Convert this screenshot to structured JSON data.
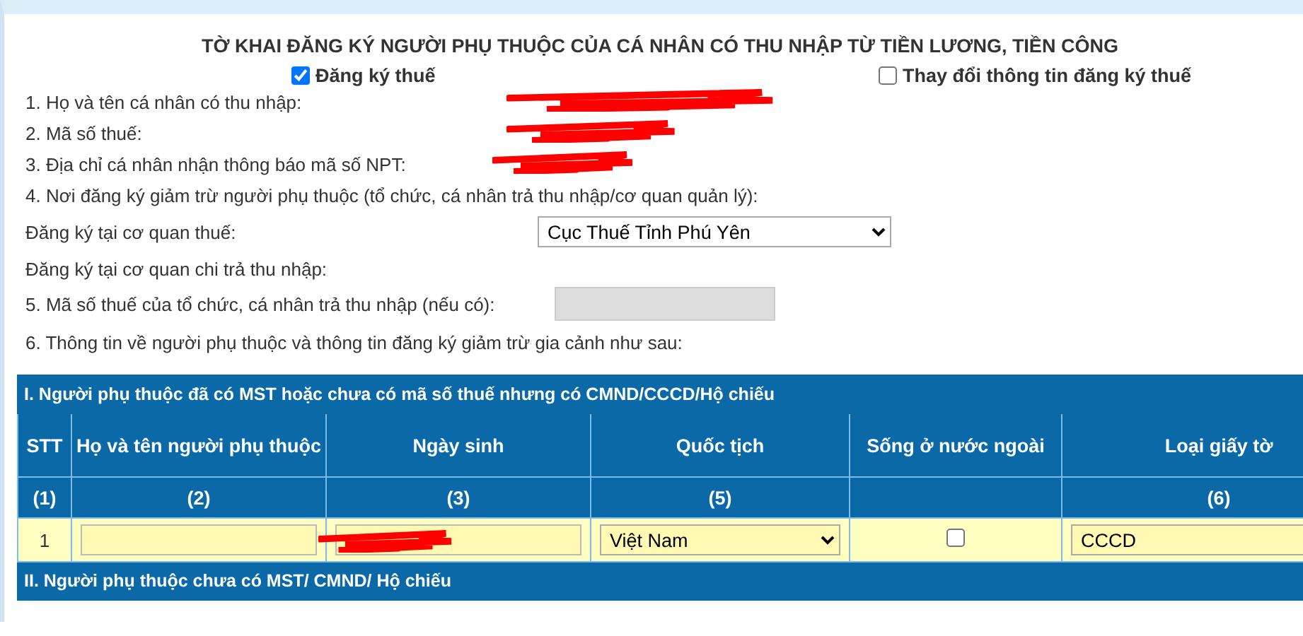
{
  "form": {
    "title": "TỜ KHAI ĐĂNG KÝ NGƯỜI PHỤ THUỘC CỦA CÁ NHÂN CÓ THU NHẬP TỪ TIỀN LƯƠNG, TIỀN CÔNG",
    "registration_types": [
      {
        "label": "Đăng ký thuế",
        "checked": true
      },
      {
        "label": "Thay đổi thông tin đăng ký thuế",
        "checked": false
      }
    ],
    "taxpayer_fields": [
      {
        "label": "1. Họ và tên cá nhân có thu nhập:",
        "redacted": true
      },
      {
        "label": "2. Mã số thuế:",
        "redacted": true
      },
      {
        "label": "3. Địa chỉ cá nhân nhận thông báo mã số NPT:",
        "redacted": true
      }
    ],
    "section_4": "4. Nơi đăng ký giảm trừ người phụ thuộc (tổ chức, cá nhân trả thu nhập/cơ quan quản lý):",
    "tax_office": {
      "label": "Đăng ký tại cơ quan thuế:",
      "value": "Cục Thuế Tỉnh Phú Yên"
    },
    "payer_office": "Đăng ký tại cơ quan chi trả thu nhập:",
    "payer_tax_code": {
      "label": "5. Mã số thuế của tổ chức, cá nhân trả thu nhập (nếu có):",
      "disabled": true
    },
    "section_6": "6. Thông tin về người phụ thuộc và thông tin đăng ký giảm trừ gia cảnh như sau:"
  },
  "dependents_table": {
    "section_title": "I. Người phụ thuộc đã có MST hoặc chưa có mã số thuế nhưng có CMND/CCCD/Hộ chiếu",
    "columns": [
      {
        "title": "STT",
        "number": "(1)"
      },
      {
        "title": "Họ và tên người phụ thuộc",
        "number": "(2)"
      },
      {
        "title": "Ngày sinh",
        "number": "(3)"
      },
      {
        "title": "Quốc tịch",
        "number": "(5)"
      },
      {
        "title": "Sống ở nước ngoài"
      },
      {
        "title": "Loại giấy tờ",
        "number": "(6)"
      }
    ],
    "rows": [
      {
        "stt": "1",
        "dob_redacted": true,
        "nationality": "Việt Nam",
        "lives_abroad": false,
        "document_type": "CCCD"
      }
    ]
  },
  "next_section": {
    "title": "II. Người phụ thuộc chưa có MST/ CMND/ Hộ chiếu"
  }
}
